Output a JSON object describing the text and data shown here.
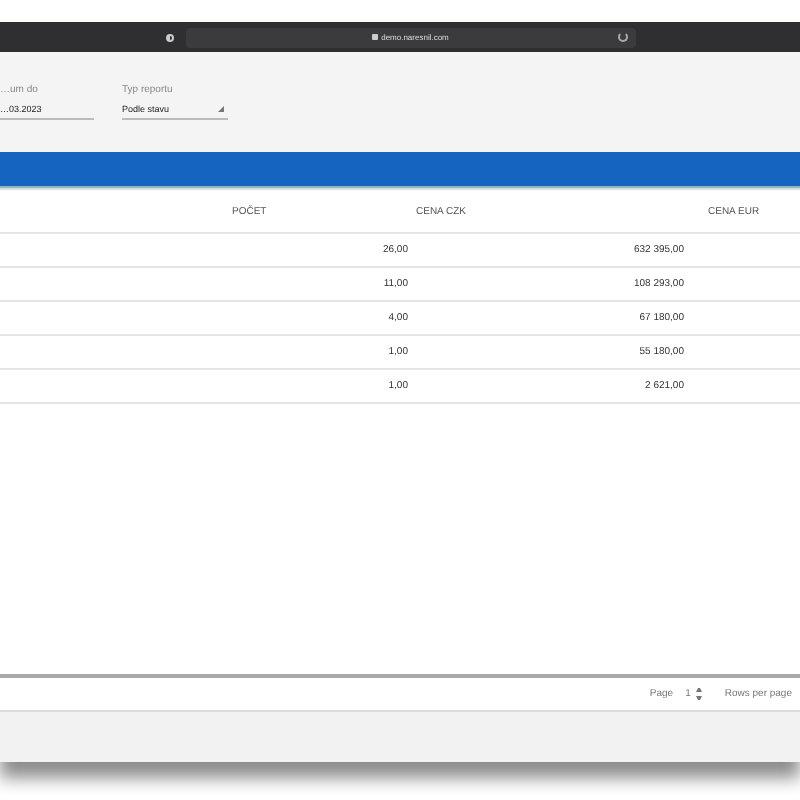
{
  "browser": {
    "url": "demo.naresnil.com"
  },
  "filters": [
    {
      "label": "…um do",
      "value": "…03.2023",
      "kind": "date"
    },
    {
      "label": "Typ reportu",
      "value": "Podle stavu",
      "kind": "select"
    }
  ],
  "table": {
    "columns": [
      "POČET",
      "CENA CZK",
      "CENA EUR"
    ],
    "rows": [
      {
        "cells": [
          "26,00",
          "632 395,00"
        ]
      },
      {
        "cells": [
          "11,00",
          "108 293,00"
        ]
      },
      {
        "cells": [
          "4,00",
          "67 180,00"
        ]
      },
      {
        "cells": [
          "1,00",
          "55 180,00"
        ]
      },
      {
        "cells": [
          "1,00",
          "2 621,00"
        ]
      }
    ]
  },
  "pagination": {
    "page_label": "Page",
    "page": "1",
    "rows_label": "Rows per page"
  }
}
